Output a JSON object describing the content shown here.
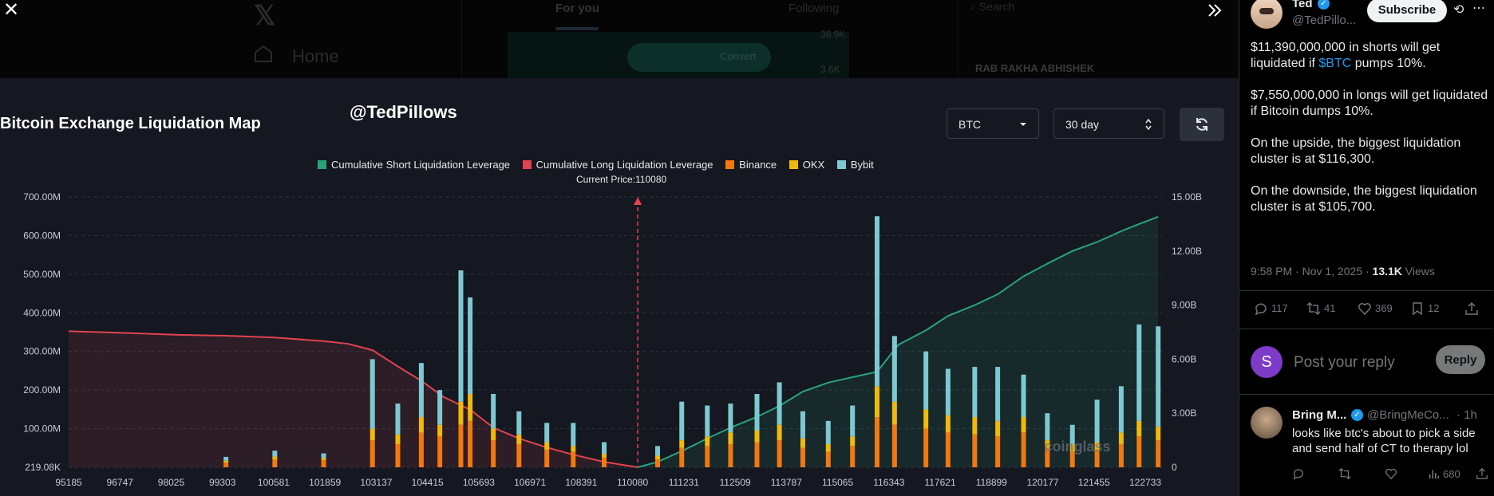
{
  "background_feed": {
    "home_label": "Home",
    "tab_for_you": "For you",
    "tab_following": "Following",
    "search_placeholder": "Search",
    "trend_name": "RAB RAKHA ABHISHEK",
    "preview_pill": "Convert",
    "num1": "38.9K",
    "num2": "3.6K"
  },
  "chart_header": {
    "title": "Bitcoin Exchange Liquidation Map",
    "watermark_handle": "@TedPillows",
    "symbol_select": "BTC",
    "range_select": "30 day",
    "current_price_label": "Current Price:110080",
    "watermark": "coinglass"
  },
  "colors": {
    "short": "#2aa37c",
    "long": "#e0434f",
    "binance": "#f2780f",
    "okx": "#f0b90b",
    "bybit": "#7ec8d1",
    "accent": "#1d9bf0"
  },
  "chart_data": {
    "type": "bar",
    "legend": [
      "Cumulative Short Liquidation Leverage",
      "Cumulative Long Liquidation Leverage",
      "Binance",
      "OKX",
      "Bybit"
    ],
    "x_tick_labels": [
      "95185",
      "96747",
      "98025",
      "99303",
      "100581",
      "101859",
      "103137",
      "104415",
      "105693",
      "106971",
      "108391",
      "110080",
      "111231",
      "112509",
      "113787",
      "115065",
      "116343",
      "117621",
      "118899",
      "120177",
      "121455",
      "122733"
    ],
    "x_range": [
      95185,
      123800
    ],
    "y_left_ticks": [
      "219.08K",
      "100.00M",
      "200.00M",
      "300.00M",
      "400.00M",
      "500.00M",
      "600.00M",
      "700.00M"
    ],
    "y_left_range_millions": [
      0,
      700
    ],
    "y_right_ticks": [
      "0",
      "3.00B",
      "6.00B",
      "9.00B",
      "12.00B",
      "15.00B"
    ],
    "y_right_range_billions": [
      0,
      15
    ],
    "current_price": 110080,
    "long_cumulative_billions": {
      "x": [
        95185,
        96747,
        98025,
        99303,
        100581,
        101859,
        102500,
        103137,
        103800,
        104415,
        105000,
        105693,
        106300,
        106971,
        107700,
        108391,
        109200,
        110080
      ],
      "y": [
        7.55,
        7.45,
        7.35,
        7.3,
        7.2,
        7.0,
        6.85,
        6.5,
        5.6,
        4.8,
        3.9,
        3.2,
        2.2,
        1.6,
        1.1,
        0.7,
        0.3,
        0.0
      ]
    },
    "short_cumulative_billions": {
      "x": [
        110080,
        110600,
        111231,
        111900,
        112509,
        113200,
        113787,
        114400,
        115065,
        115700,
        116343,
        116900,
        117621,
        118200,
        118899,
        119500,
        120177,
        120800,
        121455,
        122100,
        122733,
        123200,
        123700
      ],
      "y": [
        0.0,
        0.3,
        0.9,
        1.6,
        2.2,
        2.8,
        3.4,
        4.2,
        4.7,
        5.0,
        5.3,
        6.8,
        7.6,
        8.4,
        9.0,
        9.6,
        10.6,
        11.3,
        12.0,
        12.5,
        13.1,
        13.5,
        13.9
      ]
    },
    "bars_millions": [
      {
        "x": 99303,
        "binance": 12,
        "okx": 5,
        "bybit": 10
      },
      {
        "x": 100581,
        "binance": 20,
        "okx": 8,
        "bybit": 15
      },
      {
        "x": 101859,
        "binance": 18,
        "okx": 6,
        "bybit": 12
      },
      {
        "x": 103137,
        "binance": 70,
        "okx": 30,
        "bybit": 180
      },
      {
        "x": 103800,
        "binance": 60,
        "okx": 25,
        "bybit": 80
      },
      {
        "x": 104415,
        "binance": 90,
        "okx": 40,
        "bybit": 140
      },
      {
        "x": 104900,
        "binance": 80,
        "okx": 30,
        "bybit": 90
      },
      {
        "x": 105450,
        "binance": 110,
        "okx": 60,
        "bybit": 340
      },
      {
        "x": 105693,
        "binance": 120,
        "okx": 70,
        "bybit": 250
      },
      {
        "x": 106300,
        "binance": 70,
        "okx": 30,
        "bybit": 90
      },
      {
        "x": 106971,
        "binance": 60,
        "okx": 25,
        "bybit": 60
      },
      {
        "x": 107700,
        "binance": 45,
        "okx": 20,
        "bybit": 50
      },
      {
        "x": 108391,
        "binance": 40,
        "okx": 15,
        "bybit": 60
      },
      {
        "x": 109200,
        "binance": 25,
        "okx": 10,
        "bybit": 30
      },
      {
        "x": 110600,
        "binance": 20,
        "okx": 10,
        "bybit": 25
      },
      {
        "x": 111231,
        "binance": 50,
        "okx": 20,
        "bybit": 100
      },
      {
        "x": 111900,
        "binance": 55,
        "okx": 25,
        "bybit": 80
      },
      {
        "x": 112509,
        "binance": 60,
        "okx": 30,
        "bybit": 75
      },
      {
        "x": 113200,
        "binance": 65,
        "okx": 30,
        "bybit": 95
      },
      {
        "x": 113787,
        "binance": 70,
        "okx": 40,
        "bybit": 110
      },
      {
        "x": 114400,
        "binance": 50,
        "okx": 25,
        "bybit": 70
      },
      {
        "x": 115065,
        "binance": 40,
        "okx": 20,
        "bybit": 60
      },
      {
        "x": 115700,
        "binance": 55,
        "okx": 25,
        "bybit": 80
      },
      {
        "x": 116343,
        "binance": 130,
        "okx": 80,
        "bybit": 440
      },
      {
        "x": 116800,
        "binance": 110,
        "okx": 60,
        "bybit": 170
      },
      {
        "x": 117621,
        "binance": 100,
        "okx": 50,
        "bybit": 150
      },
      {
        "x": 118200,
        "binance": 90,
        "okx": 45,
        "bybit": 120
      },
      {
        "x": 118899,
        "binance": 85,
        "okx": 45,
        "bybit": 130
      },
      {
        "x": 119500,
        "binance": 80,
        "okx": 40,
        "bybit": 140
      },
      {
        "x": 120177,
        "binance": 90,
        "okx": 40,
        "bybit": 110
      },
      {
        "x": 120800,
        "binance": 50,
        "okx": 20,
        "bybit": 70
      },
      {
        "x": 121455,
        "binance": 40,
        "okx": 20,
        "bybit": 50
      },
      {
        "x": 122100,
        "binance": 45,
        "okx": 20,
        "bybit": 110
      },
      {
        "x": 122733,
        "binance": 60,
        "okx": 30,
        "bybit": 120
      },
      {
        "x": 123200,
        "binance": 80,
        "okx": 40,
        "bybit": 250
      },
      {
        "x": 123700,
        "binance": 70,
        "okx": 35,
        "bybit": 260
      }
    ]
  },
  "post": {
    "author_name": "Ted",
    "author_handle": "@TedPillo...",
    "subscribe_label": "Subscribe",
    "paragraph1_pre": "$11,390,000,000 in shorts will get liquidated if ",
    "paragraph1_cashtag": "$BTC",
    "paragraph1_post": " pumps 10%.",
    "paragraph2": "$7,550,000,000 in longs will get liquidated if Bitcoin dumps 10%.",
    "paragraph3": "On the upside, the biggest liquidation cluster is at $116,300.",
    "paragraph4": "On the downside, the biggest liquidation cluster is at $105,700.",
    "timestamp": "9:58 PM · Nov 1, 2025 · ",
    "views_count": "13.1K",
    "views_label": " Views",
    "replies": "117",
    "reposts": "41",
    "likes": "369",
    "bookmarks": "12"
  },
  "reply_box": {
    "avatar_letter": "S",
    "placeholder": "Post your reply",
    "button_label": "Reply"
  },
  "reply": {
    "name": "Bring M...",
    "handle": "@BringMeCo...",
    "time": "· 1h",
    "text": "looks like btc's about to pick a side and send half of CT to therapy lol",
    "views": "680"
  }
}
